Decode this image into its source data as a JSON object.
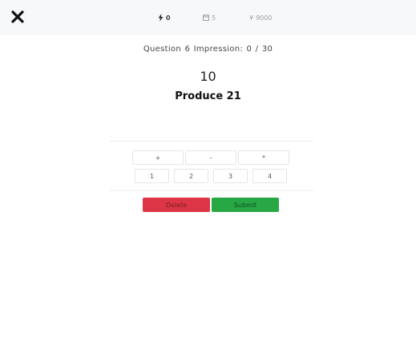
{
  "header": {
    "close_icon": "close-icon",
    "stats": {
      "energy": {
        "icon": "bolt-icon",
        "value": "0"
      },
      "days": {
        "icon": "calendar-icon",
        "value": "5"
      },
      "money": {
        "icon": "yen-icon",
        "symbol": "¥",
        "value": "9000"
      }
    }
  },
  "question": {
    "label": "Question",
    "number": "6",
    "impression_label": "Impression:",
    "impression_current": "0",
    "separator": "/",
    "impression_total": "30"
  },
  "puzzle": {
    "start_number": "10",
    "goal": "Produce 21"
  },
  "keypad": {
    "operators": [
      "+",
      "-",
      "*"
    ],
    "numbers": [
      "1",
      "2",
      "3",
      "4"
    ]
  },
  "actions": {
    "delete_label": "Delete",
    "submit_label": "Submit"
  },
  "colors": {
    "delete": "#dc3545",
    "submit": "#28a745",
    "topbar": "#f7f8fa"
  }
}
